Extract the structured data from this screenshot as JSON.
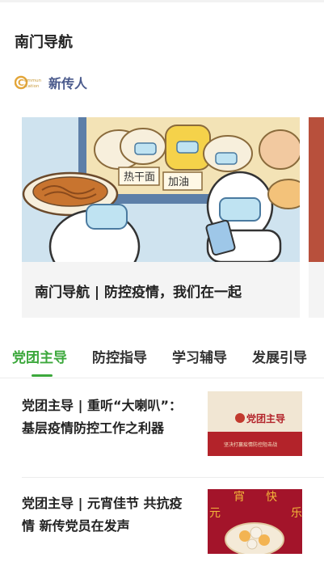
{
  "page": {
    "title": "南门导航"
  },
  "account": {
    "name": "新传人",
    "logo_text_top": "ommun",
    "logo_text_bottom": "ication",
    "logo_letter": "C"
  },
  "featured": {
    "caption": "南门导航 | 防控疫情，我们在一起",
    "image_signs": [
      "热干面",
      "加油"
    ]
  },
  "tabs": [
    {
      "label": "党团主导",
      "active": true
    },
    {
      "label": "防控指导",
      "active": false
    },
    {
      "label": "学习辅导",
      "active": false
    },
    {
      "label": "发展引导",
      "active": false
    }
  ],
  "articles": [
    {
      "title": "党团主导 | 重听“大喇叭”：基层疫情防控工作之利器",
      "thumb_title": "党团主导",
      "thumb_subtitle": "坚决打赢疫情防控阻击战"
    },
    {
      "title": "党团主导 | 元宵佳节 共抗疫情 新传党员在发声",
      "thumb_chars": [
        "元",
        "宵",
        "快",
        "乐"
      ]
    }
  ],
  "colors": {
    "accent": "#3ca83c",
    "account": "#4a5a8c",
    "thumb_red": "#b3232a"
  }
}
